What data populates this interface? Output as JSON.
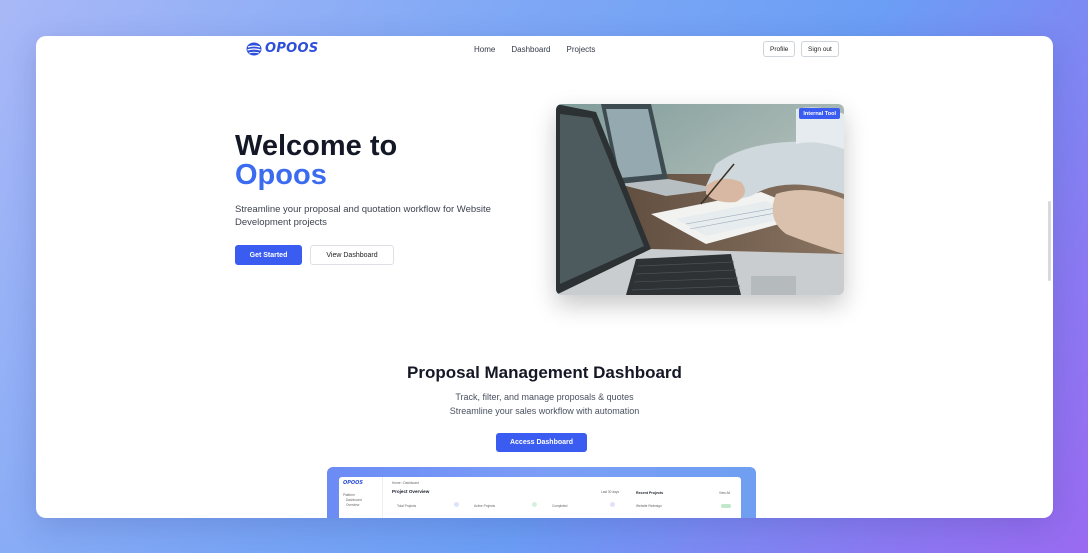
{
  "nav": {
    "logo_text": "OPOOS",
    "links": [
      "Home",
      "Dashboard",
      "Projects"
    ],
    "profile_label": "Profile",
    "signout_label": "Sign out"
  },
  "hero": {
    "title_line1": "Welcome to",
    "title_line2": "Opoos",
    "subtitle": "Streamline your proposal and quotation workflow for Website Development projects",
    "primary_button": "Get Started",
    "secondary_button": "View Dashboard",
    "image_badge": "Internal Tool"
  },
  "dashboard_section": {
    "title": "Proposal Management Dashboard",
    "subtitle_line1": "Track, filter, and manage proposals & quotes",
    "subtitle_line2": "Streamline your sales workflow with automation",
    "button": "Access Dashboard"
  },
  "preview": {
    "logo_text": "OPOOS",
    "breadcrumb": "Home  ›  Dashboard",
    "heading": "Project Overview",
    "side_section": "Platform",
    "side_item_1": "Dashboard",
    "side_item_2": "Overview",
    "stat_1": "Total Projects",
    "stat_2": "Active Projects",
    "stat_3": "Completed",
    "recent_heading": "Recent Projects",
    "view_all": "View All",
    "row_1": "Website Redesign",
    "last_days": "Last 30 days"
  },
  "colors": {
    "accent": "#3b5cf0",
    "title_accent": "#3b6cf0",
    "logo": "#2e4fd9"
  }
}
